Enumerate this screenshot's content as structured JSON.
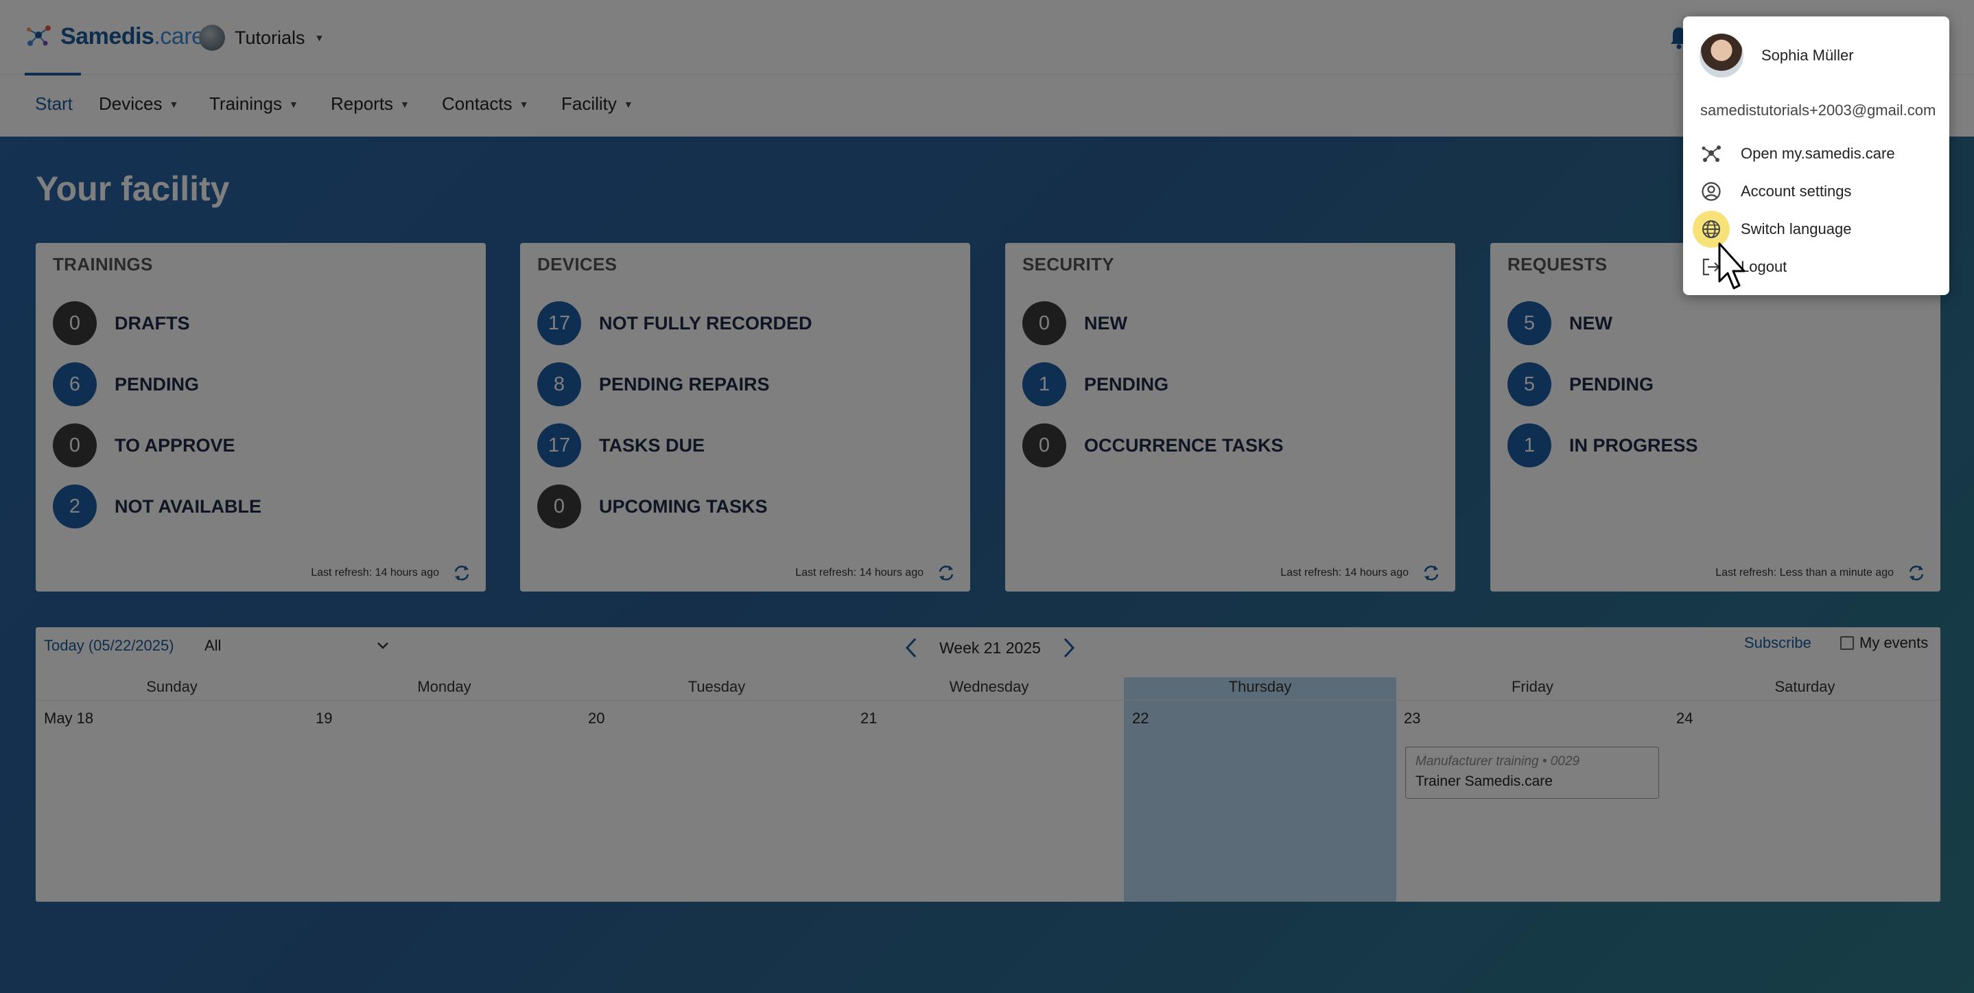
{
  "header": {
    "logo_main": "Samedis",
    "logo_suffix": ".care",
    "tenant": "Tutorials"
  },
  "nav": {
    "items": [
      {
        "label": "Start",
        "active": true
      },
      {
        "label": "Devices"
      },
      {
        "label": "Trainings"
      },
      {
        "label": "Reports"
      },
      {
        "label": "Contacts"
      },
      {
        "label": "Facility"
      }
    ]
  },
  "page": {
    "title": "Your facility"
  },
  "cards": [
    {
      "title": "TRAININGS",
      "rows": [
        {
          "count": "0",
          "label": "DRAFTS",
          "tone": "dark"
        },
        {
          "count": "6",
          "label": "PENDING",
          "tone": "blue"
        },
        {
          "count": "0",
          "label": "TO APPROVE",
          "tone": "dark"
        },
        {
          "count": "2",
          "label": "NOT AVAILABLE",
          "tone": "blue"
        }
      ],
      "footer": "Last refresh: 14 hours ago"
    },
    {
      "title": "DEVICES",
      "rows": [
        {
          "count": "17",
          "label": "NOT FULLY RECORDED",
          "tone": "blue"
        },
        {
          "count": "8",
          "label": "PENDING REPAIRS",
          "tone": "blue"
        },
        {
          "count": "17",
          "label": "TASKS DUE",
          "tone": "blue"
        },
        {
          "count": "0",
          "label": "UPCOMING TASKS",
          "tone": "dark"
        }
      ],
      "footer": "Last refresh: 14 hours ago"
    },
    {
      "title": "SECURITY",
      "rows": [
        {
          "count": "0",
          "label": "NEW",
          "tone": "dark"
        },
        {
          "count": "1",
          "label": "PENDING",
          "tone": "blue"
        },
        {
          "count": "0",
          "label": "OCCURRENCE TASKS",
          "tone": "dark"
        }
      ],
      "footer": "Last refresh: 14 hours ago"
    },
    {
      "title": "REQUESTS",
      "rows": [
        {
          "count": "5",
          "label": "NEW",
          "tone": "blue"
        },
        {
          "count": "5",
          "label": "PENDING",
          "tone": "blue"
        },
        {
          "count": "1",
          "label": "IN PROGRESS",
          "tone": "blue"
        }
      ],
      "footer": "Last refresh: Less than a minute ago"
    }
  ],
  "calendar": {
    "today_label": "Today (05/22/2025)",
    "filter_value": "All",
    "week_label": "Week 21 2025",
    "subscribe_label": "Subscribe",
    "my_events_label": "My events",
    "days": [
      "Sunday",
      "Monday",
      "Tuesday",
      "Wednesday",
      "Thursday",
      "Friday",
      "Saturday"
    ],
    "dates": [
      "May 18",
      "19",
      "20",
      "21",
      "22",
      "23",
      "24"
    ],
    "event": {
      "type": "Manufacturer training • 0029",
      "title": "Trainer Samedis.care"
    }
  },
  "user_menu": {
    "name": "Sophia Müller",
    "email": "samedistutorials+2003@gmail.com",
    "items": [
      {
        "label": "Open my.samedis.care",
        "icon": "network-logo-icon"
      },
      {
        "label": "Account settings",
        "icon": "account-circle-icon"
      },
      {
        "label": "Switch language",
        "icon": "globe-icon"
      },
      {
        "label": "Logout",
        "icon": "logout-icon"
      }
    ]
  },
  "colors": {
    "brand": "#1b5b9c",
    "badge_blue": "#1c5ca4",
    "badge_dark": "#3a3a3a"
  }
}
